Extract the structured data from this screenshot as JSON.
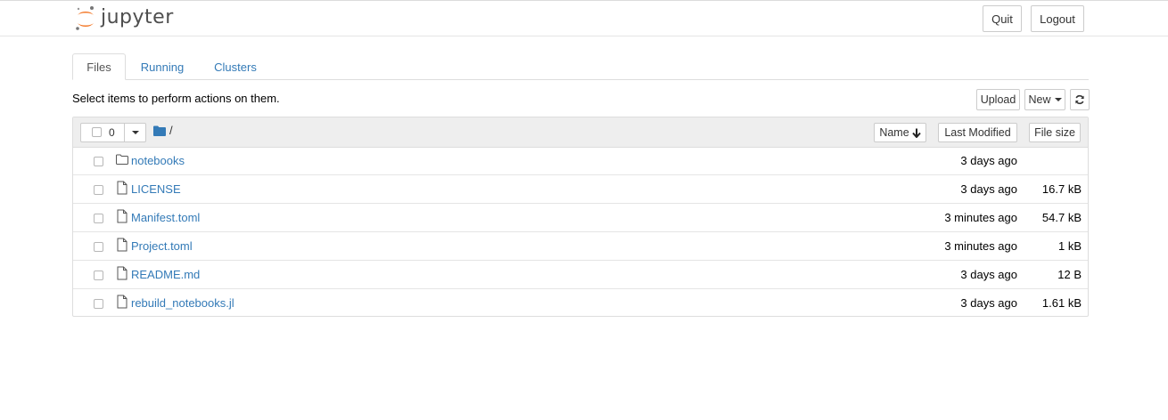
{
  "header": {
    "logo_text": "jupyter",
    "quit_label": "Quit",
    "logout_label": "Logout"
  },
  "tabs": [
    {
      "label": "Files",
      "active": true
    },
    {
      "label": "Running",
      "active": false
    },
    {
      "label": "Clusters",
      "active": false
    }
  ],
  "toolbar": {
    "hint": "Select items to perform actions on them.",
    "upload_label": "Upload",
    "new_label": "New",
    "refresh_icon": "refresh-icon"
  },
  "list_header": {
    "selected_count": "0",
    "breadcrumb": "/",
    "sort_name_label": "Name",
    "sort_modified_label": "Last Modified",
    "sort_size_label": "File size"
  },
  "files": [
    {
      "name": "notebooks",
      "type": "folder",
      "modified": "3 days ago",
      "size": ""
    },
    {
      "name": "LICENSE",
      "type": "file",
      "modified": "3 days ago",
      "size": "16.7 kB"
    },
    {
      "name": "Manifest.toml",
      "type": "file",
      "modified": "3 minutes ago",
      "size": "54.7 kB"
    },
    {
      "name": "Project.toml",
      "type": "file",
      "modified": "3 minutes ago",
      "size": "1 kB"
    },
    {
      "name": "README.md",
      "type": "file",
      "modified": "3 days ago",
      "size": "12 B"
    },
    {
      "name": "rebuild_notebooks.jl",
      "type": "file",
      "modified": "3 days ago",
      "size": "1.61 kB"
    }
  ],
  "colors": {
    "link": "#337ab7",
    "logo_orange": "#f37726",
    "logo_gray": "#767677"
  }
}
